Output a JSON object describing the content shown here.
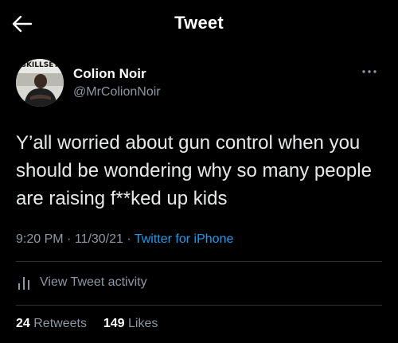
{
  "header": {
    "title": "Tweet",
    "back_icon": "arrow-left-icon"
  },
  "author": {
    "name": "Colion Noir",
    "handle": "@MrColionNoir",
    "avatar_text": "SKILLSET"
  },
  "tweet": {
    "text": "Y’all worried about gun control when you should be wondering why so many people are raising f**ked up kids",
    "time": "9:20 PM",
    "date": "11/30/21",
    "source": "Twitter for iPhone",
    "separator": "·"
  },
  "activity": {
    "label": "View Tweet activity",
    "icon": "bar-chart-icon"
  },
  "stats": {
    "retweets_count": "24",
    "retweets_label": "Retweets",
    "likes_count": "149",
    "likes_label": "Likes"
  },
  "colors": {
    "background": "#000000",
    "text": "#e7e9ea",
    "secondary": "#8b98a5",
    "accent": "#1d9bf0",
    "divider": "#2f3336"
  }
}
